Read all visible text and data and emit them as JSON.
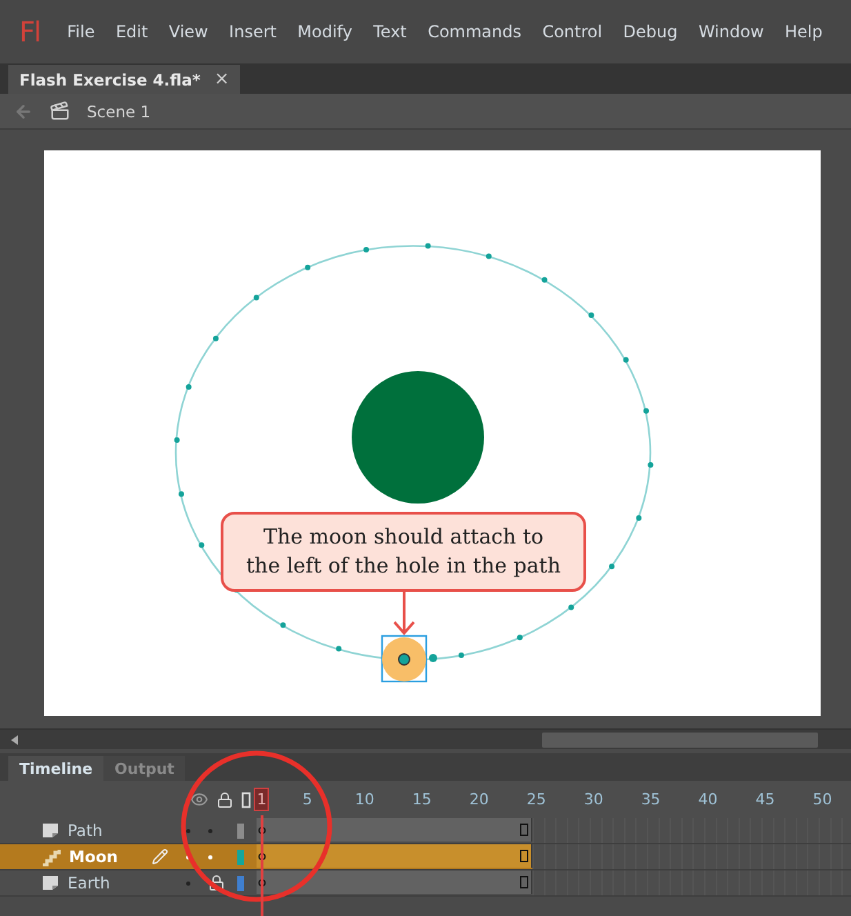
{
  "menu_bar": {
    "logo": "Fl",
    "items": [
      "File",
      "Edit",
      "View",
      "Insert",
      "Modify",
      "Text",
      "Commands",
      "Control",
      "Debug",
      "Window",
      "Help"
    ]
  },
  "document_tabs": [
    {
      "label": "Flash Exercise 4.fla*",
      "selected": true,
      "close": "×"
    }
  ],
  "breadcrumb": {
    "scene": "Scene 1"
  },
  "stage": {
    "callout": "The moon should attach to\nthe left of the hole in the path"
  },
  "panel_tabs": [
    {
      "label": "Timeline",
      "selected": true
    },
    {
      "label": "Output",
      "selected": false
    }
  ],
  "timeline": {
    "current_frame": "1",
    "frame_numbers": [
      "5",
      "10",
      "15",
      "20",
      "25",
      "30",
      "35",
      "40",
      "45",
      "50"
    ],
    "layers": [
      {
        "name": "Path",
        "kind": "normal",
        "selected": false,
        "locked": false,
        "color": "#8c8c8c"
      },
      {
        "name": "Moon",
        "kind": "guided",
        "selected": true,
        "locked": false,
        "color": "#14a69b"
      },
      {
        "name": "Earth",
        "kind": "normal",
        "selected": false,
        "locked": true,
        "color": "#3f7fcf"
      }
    ]
  }
}
